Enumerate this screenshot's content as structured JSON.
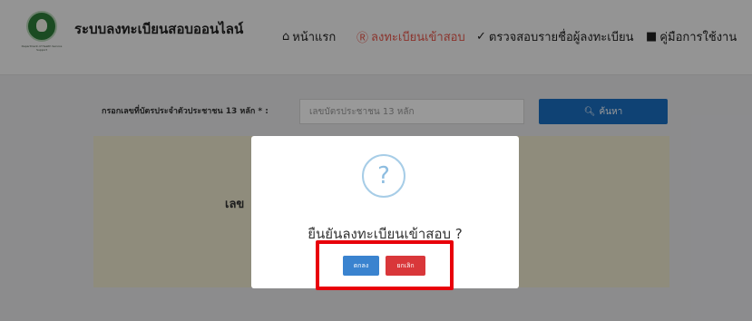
{
  "navbar": {
    "brand": "ระบบลงทะเบียนสอบออนไลน์",
    "logo_text": "Department of Health Service Support",
    "items": [
      {
        "label": "หน้าแรก",
        "icon": "home-icon"
      },
      {
        "label": "ลงทะเบียนเข้าสอบ",
        "icon": "circle-r-icon",
        "active": true
      },
      {
        "label": "ตรวจสอบรายชื่อผู้ลงทะเบียน",
        "icon": "check-circle-icon"
      },
      {
        "label": "คู่มือการใช้งาน",
        "icon": "book-icon"
      }
    ]
  },
  "form": {
    "id_label": "กรอกเลขที่บัตรประจำตัวประชาชน 13 หลัก * :",
    "id_placeholder": "เลขบัตรประชาชน 13 หลัก",
    "search_label": "ค้นหา"
  },
  "result": {
    "text": "เลข"
  },
  "modal": {
    "icon_glyph": "?",
    "title": "ยืนยันลงทะเบียนเข้าสอบ ?",
    "ok_label": "ตกลง",
    "cancel_label": "ยกเลิก"
  },
  "colors": {
    "active_nav": "#e8584c",
    "search_button": "#1a6ec2",
    "ok_button": "#3a83cf",
    "cancel_button": "#d9373a",
    "highlight": "#e8000a"
  }
}
